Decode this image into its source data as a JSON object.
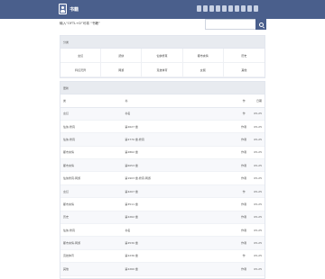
{
  "site": {
    "name": "书籍"
  },
  "nav": {
    "links": [
      "",
      "",
      "",
      "",
      "",
      "",
      "",
      "",
      "",
      ""
    ]
  },
  "header": {
    "hint": "输入“OFTL+D”可将 “书籍”",
    "search_placeholder": ""
  },
  "categories": {
    "title": "分类",
    "items": [
      "玄幻",
      "武侠",
      "仙侠修真",
      "都市言情",
      "历史",
      "科幻灵异",
      "网游",
      "竞技体育",
      "女频",
      "其他"
    ]
  },
  "table": {
    "title": "更新",
    "headers": [
      "类",
      "书",
      "作",
      "日期"
    ],
    "rows": [
      [
        "玄幻",
        "书名",
        "作",
        "05-25"
      ],
      [
        "仙侠,修真",
        "第2627 章",
        "作者",
        "05-25"
      ],
      [
        "仙侠,修真",
        "第2770 章,修真",
        "作者",
        "05-25"
      ],
      [
        "都市言情",
        "第2862 章",
        "作者",
        "05-25"
      ],
      [
        "都市言情",
        "第6053 章",
        "作者",
        "05-25"
      ],
      [
        "仙侠修真,网游",
        "第1903 章,修真,网游",
        "作者",
        "05-25"
      ],
      [
        "玄幻",
        "第4207 章",
        "作",
        "05-25"
      ],
      [
        "都市言情",
        "第3511 章",
        "作者",
        "05-25"
      ],
      [
        "历史",
        "第2262 章",
        "作者",
        "05-25"
      ],
      [
        "仙侠,修真",
        "书名",
        "作者",
        "05-25"
      ],
      [
        "都市言情,网游",
        "第4530 章",
        "作者",
        "05-25"
      ],
      [
        "竞技体育",
        "第2236 章",
        "作",
        "05-25"
      ],
      [
        "其他",
        "第2260 章",
        "作者",
        "05-25"
      ]
    ]
  }
}
